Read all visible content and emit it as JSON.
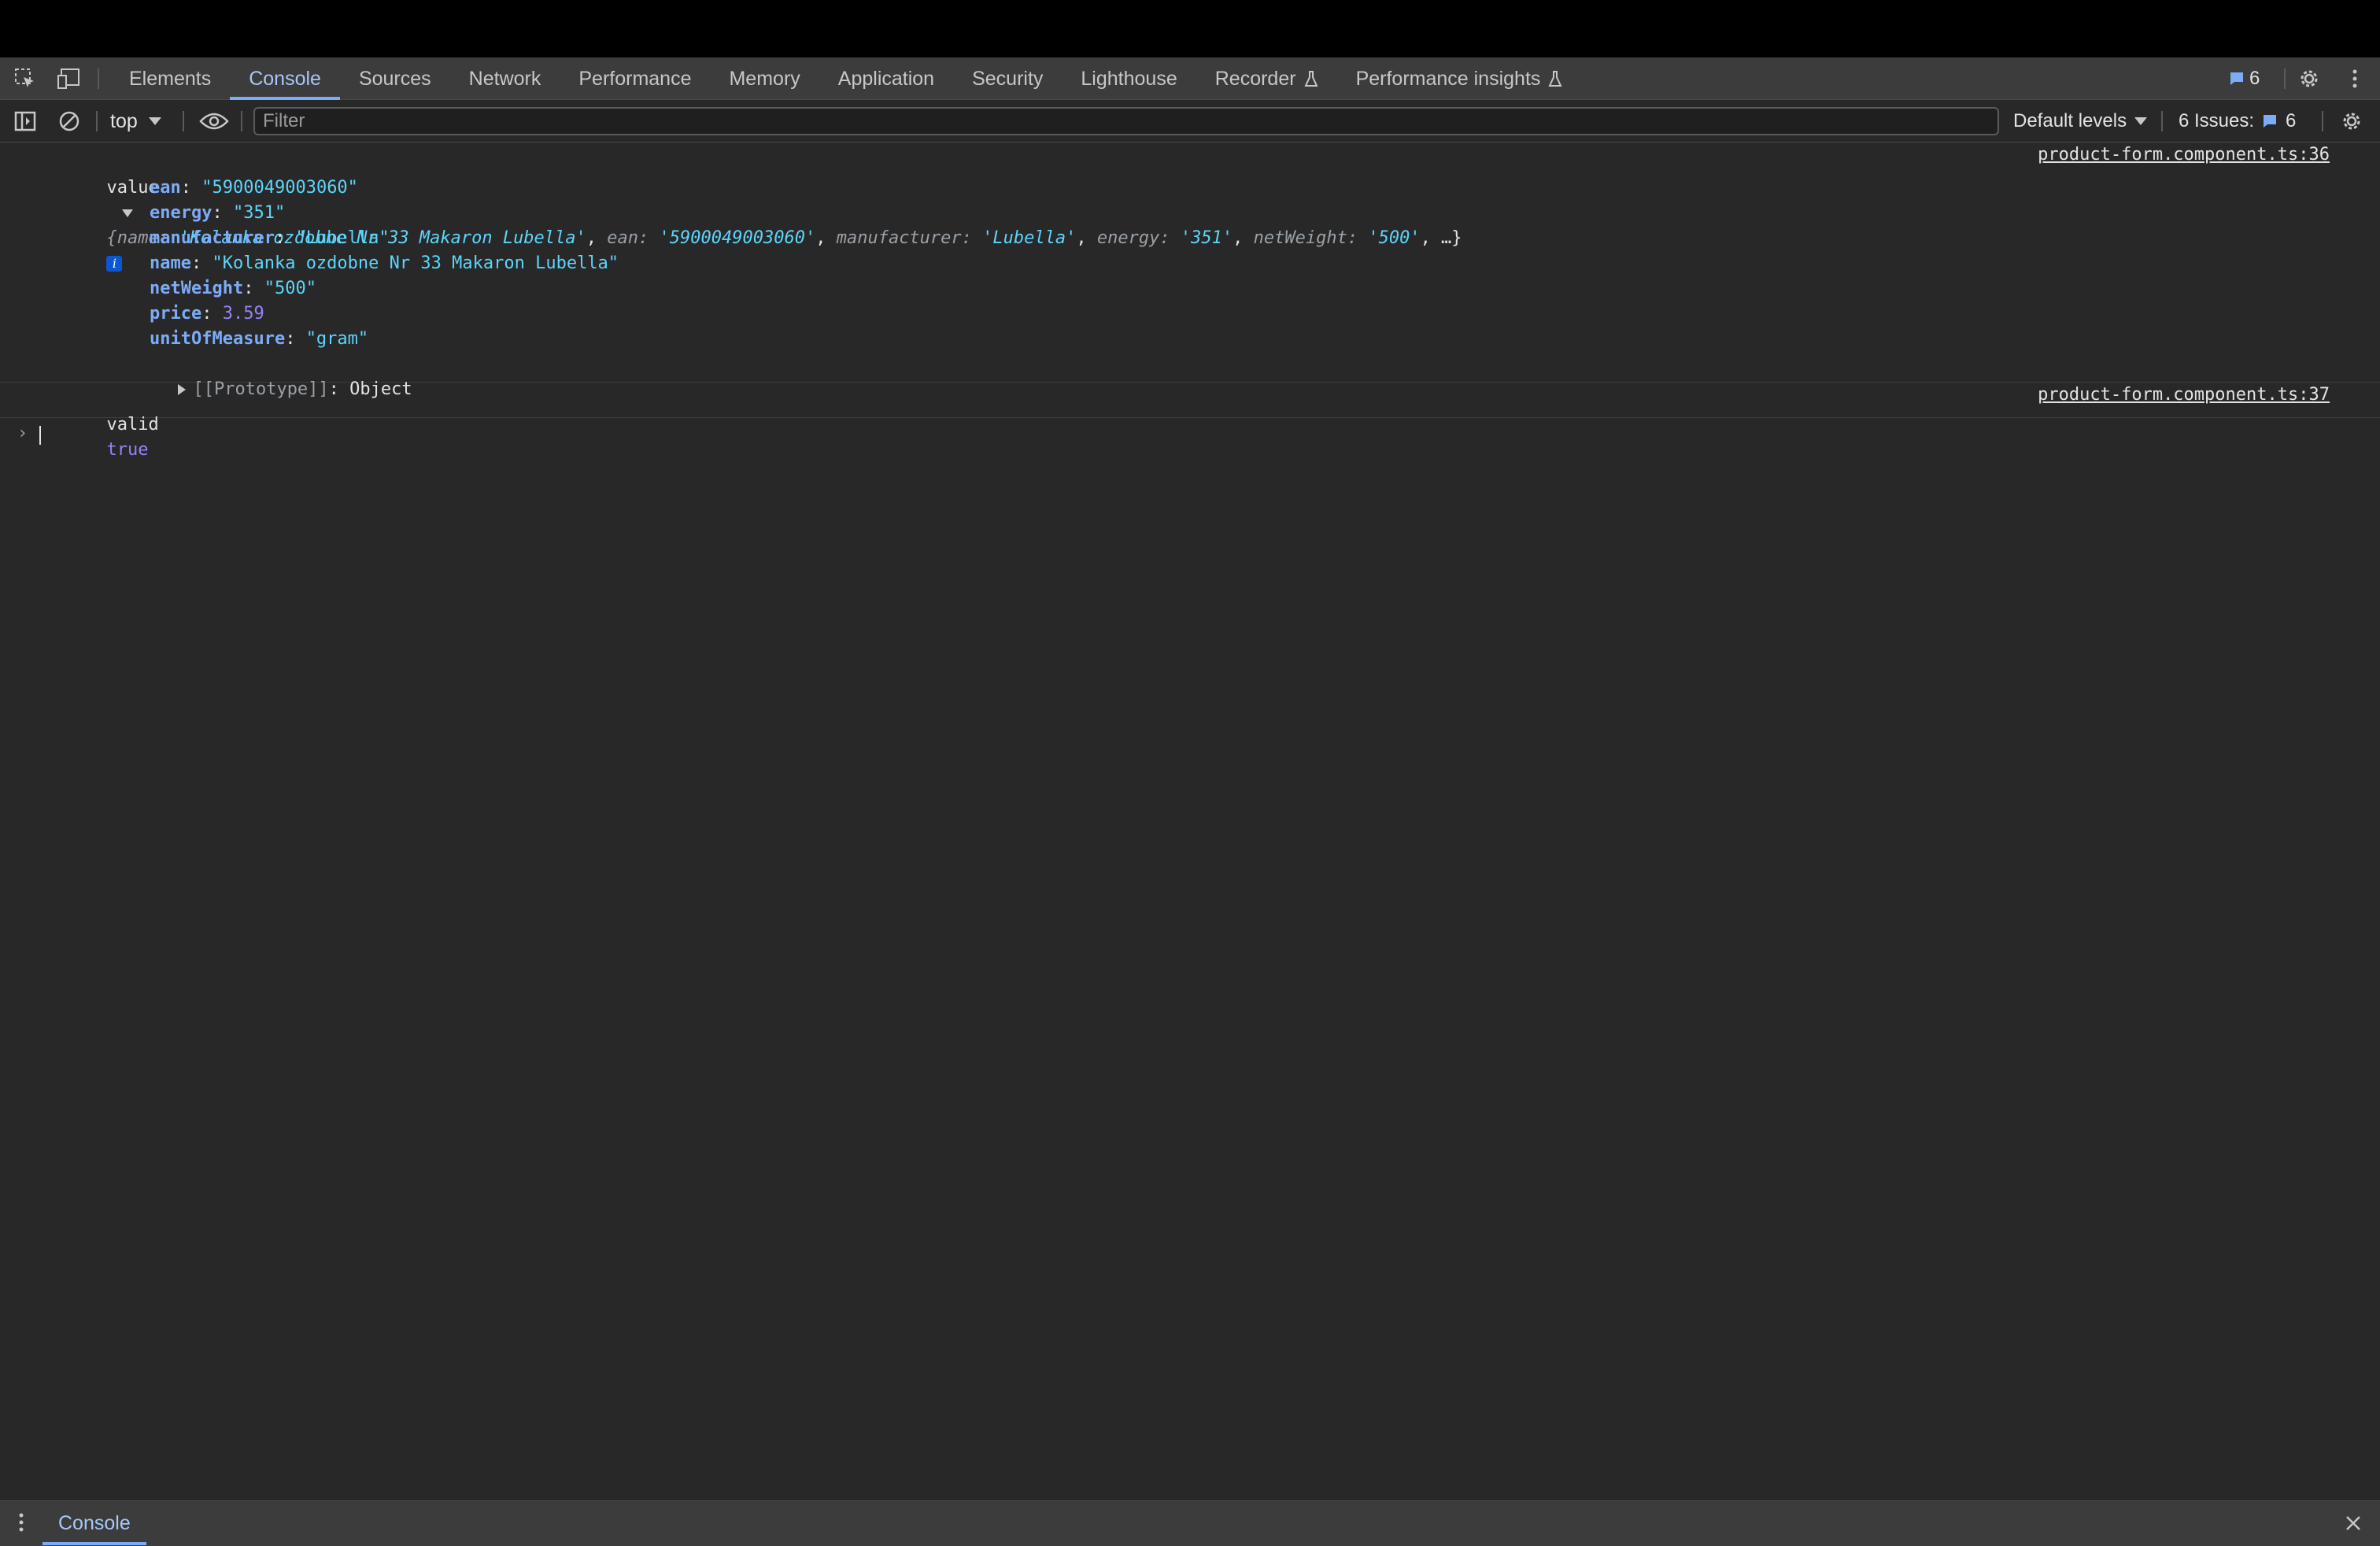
{
  "main_tabs": [
    {
      "label": "Elements"
    },
    {
      "label": "Console",
      "active": true
    },
    {
      "label": "Sources"
    },
    {
      "label": "Network"
    },
    {
      "label": "Performance"
    },
    {
      "label": "Memory"
    },
    {
      "label": "Application"
    },
    {
      "label": "Security"
    },
    {
      "label": "Lighthouse"
    },
    {
      "label": "Recorder",
      "icon": "flask-icon"
    },
    {
      "label": "Performance insights",
      "icon": "flask-icon"
    }
  ],
  "header": {
    "message_count": "6"
  },
  "toolbar": {
    "context": "top",
    "filter_placeholder": "Filter",
    "levels_label": "Default levels",
    "issues_label": "6 Issues:",
    "issues_count": "6"
  },
  "console": {
    "entry1": {
      "label": "value",
      "preview": [
        {
          "k": "name",
          "v": "'Kolanka ozdobne Nr 33 Makaron Lubella'"
        },
        {
          "k": "ean",
          "v": "'5900049003060'"
        },
        {
          "k": "manufacturer",
          "v": "'Lubella'"
        },
        {
          "k": "energy",
          "v": "'351'"
        },
        {
          "k": "netWeight",
          "v": "'500'"
        }
      ],
      "preview_tail": ", …}",
      "source": "product-form.component.ts:36",
      "props": [
        {
          "k": "ean",
          "v": "\"5900049003060\"",
          "type": "string"
        },
        {
          "k": "energy",
          "v": "\"351\"",
          "type": "string"
        },
        {
          "k": "manufacturer",
          "v": "\"Lubella\"",
          "type": "string"
        },
        {
          "k": "name",
          "v": "\"Kolanka ozdobne Nr 33 Makaron Lubella\"",
          "type": "string"
        },
        {
          "k": "netWeight",
          "v": "\"500\"",
          "type": "string"
        },
        {
          "k": "price",
          "v": "3.59",
          "type": "number"
        },
        {
          "k": "unitOfMeasure",
          "v": "\"gram\"",
          "type": "string"
        }
      ],
      "prototype_key": "[[Prototype]]",
      "prototype_value": "Object"
    },
    "entry2": {
      "label": "valid",
      "value": "true",
      "source": "product-form.component.ts:37"
    }
  },
  "drawer": {
    "tab_label": "Console"
  }
}
